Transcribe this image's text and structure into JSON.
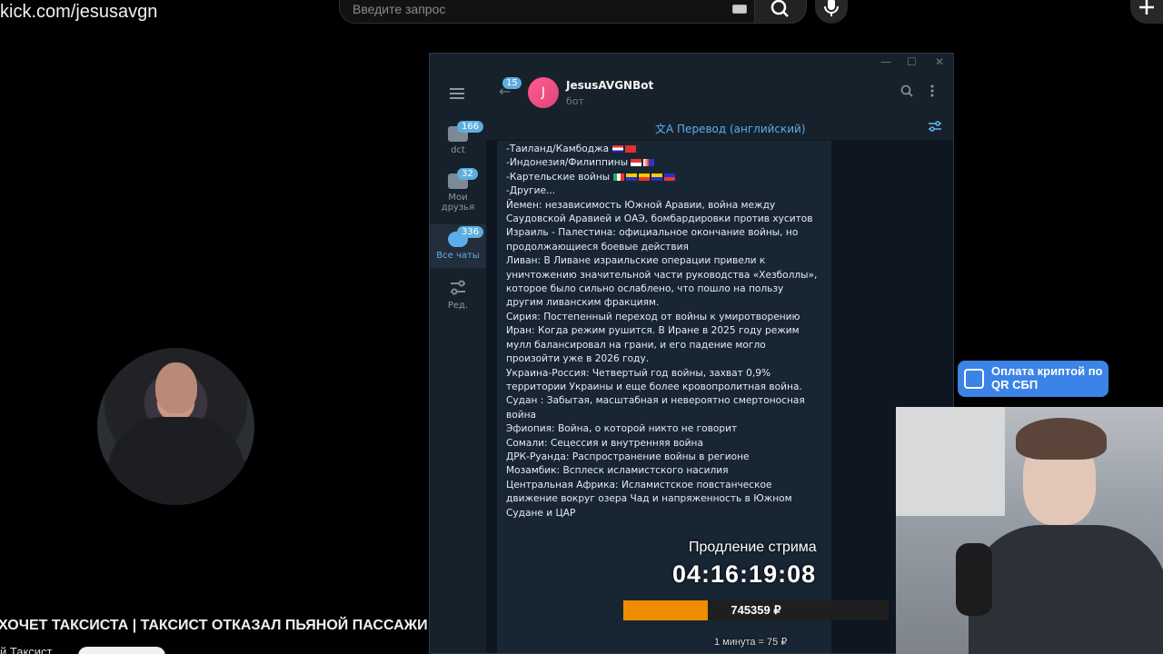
{
  "browser": {
    "url": "kick.com/jesusavgn",
    "search_placeholder": "Введите запрос"
  },
  "video": {
    "title": "ХОЧЕТ ТАКСИСТА | ТАКСИСТ ОТКАЗАЛ ПЬЯНОЙ ПАССАЖИ",
    "channel": "й Таксист"
  },
  "telegram": {
    "window_controls": [
      "—",
      "☐",
      "✕"
    ],
    "sidebar": {
      "folders": [
        {
          "label": "dct",
          "badge": "166"
        },
        {
          "label": "Мои друзья",
          "badge": "32"
        },
        {
          "label": "Все чаты",
          "badge": "336"
        },
        {
          "label": "Ред.",
          "badge": ""
        }
      ]
    },
    "header": {
      "back_badge": "15",
      "avatar_letter": "J",
      "name": "JesusAVGNBot",
      "subtitle": "бот"
    },
    "translate": {
      "label": "Перевод (английский)"
    },
    "message_lines": [
      "-Таиланд/Камбоджа",
      "-Индонезия/Филиппины",
      "-Картельские войны",
      "-Другие...",
      "",
      "Йемен: независимость Южной Аравии, война между Саудовской Аравией и ОАЭ, бомбардировки против хуситов",
      "",
      "Израиль - Палестина: официальное окончание войны, но продолжающиеся боевые действия",
      "",
      "Ливан: В Ливане израильские операции привели к уничтожению значительной части руководства «Хезболлы», которое было сильно ослаблено, что пошло на пользу другим ливанским фракциям.",
      "",
      "Сирия: Постепенный переход от войны к умиротворению",
      "",
      "Иран: Когда режим рушится. В Иране в 2025 году режим мулл балансировал на грани, и его падение могло произойти уже в 2026 году.",
      "",
      "Украина-Россия: Четвертый год войны, захват 0,9% территории Украины и еще более кровопролитная война.",
      "",
      "Судан : Забытая, масштабная и невероятно смертоносная война",
      "",
      "Эфиопия: Война, о которой никто не говорит",
      "",
      "Сомали: Сецессия и внутренняя война",
      "",
      "ДРК-Руанда: Распространение войны в регионе",
      "",
      "Мозамбик: Всплеск исламистского насилия",
      "",
      "Центральная Африка: Исламистское повстанческое движение вокруг озера Чад и напряженность в Южном Судане и ЦАР"
    ]
  },
  "overlay": {
    "qr_widget": "Оплата криптой по QR СБП",
    "prolong_title": "Продление стрима",
    "timer": "04:16:19:08",
    "progress_amount": "745359 ₽",
    "progress_fraction": 0.32,
    "rate": "1 минута = 75 ₽"
  }
}
